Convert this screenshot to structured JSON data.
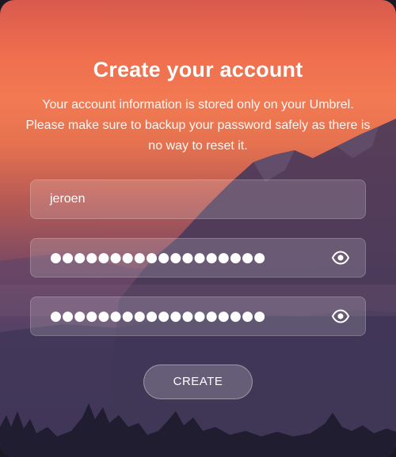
{
  "header": {
    "title": "Create your account",
    "subtitle": "Your account information is stored only on your Umbrel. Please make sure to backup your password safely as there is no way to reset it."
  },
  "form": {
    "username_value": "jeroen",
    "password_masked": "●●●●●●●●●●●●●●●●●●",
    "confirm_masked": "●●●●●●●●●●●●●●●●●●",
    "show_password_icon": "eye-icon",
    "create_label": "CREATE"
  },
  "colors": {
    "sunset_top": "#ef6e4e",
    "dusk_bottom": "#2c2a45",
    "text": "#ffffff"
  }
}
